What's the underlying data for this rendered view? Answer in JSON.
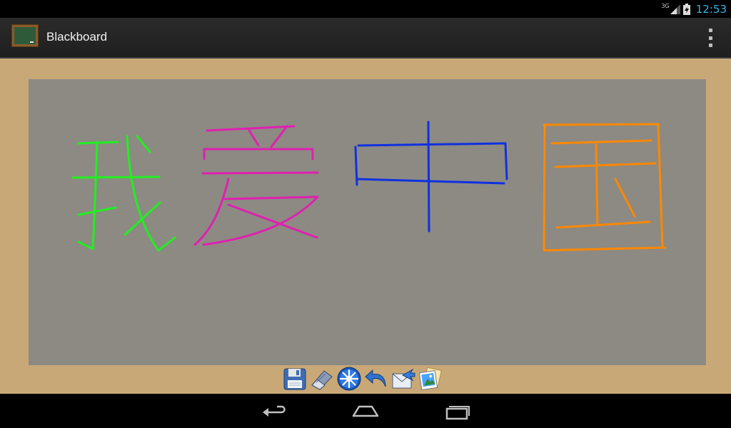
{
  "status_bar": {
    "network_type": "3G",
    "time": "12:53"
  },
  "action_bar": {
    "title": "Blackboard",
    "app_icon": "blackboard-icon",
    "overflow_icon": "overflow-menu-icon"
  },
  "canvas": {
    "background_color": "#8c8a83",
    "frame_color": "#c9a877",
    "strokes": [
      {
        "character": "我",
        "color": "#22ee22"
      },
      {
        "character": "爱",
        "color": "#e020b0"
      },
      {
        "character": "中",
        "color": "#1030e0"
      },
      {
        "character": "国",
        "color": "#ff8800"
      }
    ]
  },
  "toolbar": {
    "tools": [
      "save-icon",
      "eraser-icon",
      "brush-color-icon",
      "undo-icon",
      "share-icon",
      "gallery-icon"
    ]
  },
  "nav_bar": {
    "buttons": [
      "back-icon",
      "home-icon",
      "recent-apps-icon"
    ]
  }
}
